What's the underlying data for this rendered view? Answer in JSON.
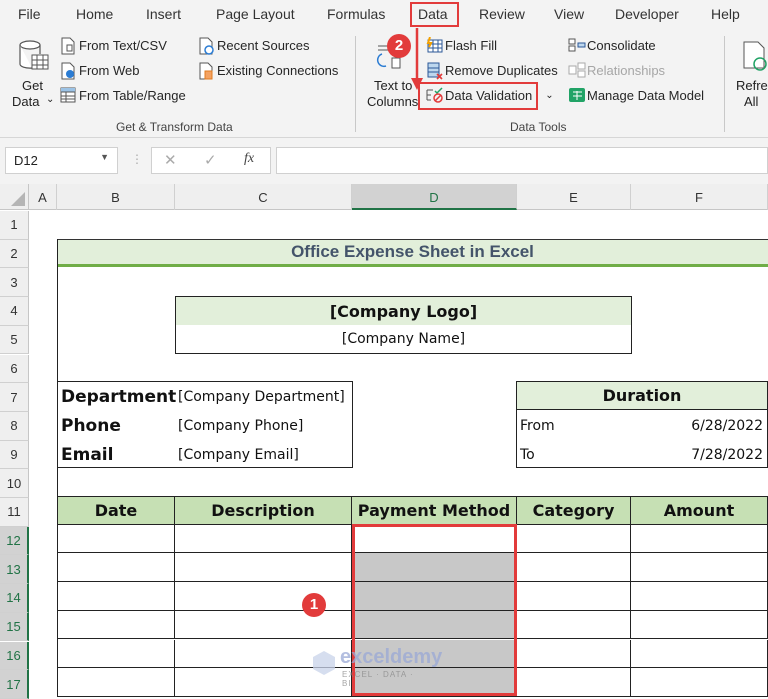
{
  "menu": {
    "tabs": [
      "File",
      "Home",
      "Insert",
      "Page Layout",
      "Formulas",
      "Data",
      "Review",
      "View",
      "Developer",
      "Help"
    ],
    "active_tab": "Data"
  },
  "ribbon": {
    "get_data": {
      "line1": "Get",
      "line2": "Data"
    },
    "from_text_csv": "From Text/CSV",
    "from_web": "From Web",
    "from_table_range": "From Table/Range",
    "recent_sources": "Recent Sources",
    "existing_connections": "Existing Connections",
    "group_get_transform": "Get & Transform Data",
    "text_to_columns": {
      "line1": "Text to",
      "line2": "Columns"
    },
    "flash_fill": "Flash Fill",
    "remove_duplicates": "Remove Duplicates",
    "data_validation": "Data Validation",
    "consolidate": "Consolidate",
    "relationships": "Relationships",
    "manage_data_model": "Manage Data Model",
    "group_data_tools": "Data Tools",
    "refresh_all": {
      "line1": "Refresh",
      "line2": "All"
    }
  },
  "formula_bar": {
    "name_box": "D12",
    "fx_label": "fx",
    "formula": ""
  },
  "columns": [
    "A",
    "B",
    "C",
    "D",
    "E",
    "F"
  ],
  "selected_column": "D",
  "rows": [
    "1",
    "2",
    "3",
    "4",
    "5",
    "6",
    "7",
    "8",
    "9",
    "10",
    "11",
    "12",
    "13",
    "14",
    "15",
    "16",
    "17"
  ],
  "sheet": {
    "title": "Office Expense Sheet in Excel",
    "company_logo": "[Company Logo]",
    "company_name": "[Company Name]",
    "info": [
      {
        "label": "Department",
        "value": "[Company Department]"
      },
      {
        "label": "Phone",
        "value": "[Company Phone]"
      },
      {
        "label": "Email",
        "value": "[Company Email]"
      }
    ],
    "duration": {
      "header": "Duration",
      "from_label": "From",
      "from_value": "6/28/2022",
      "to_label": "To",
      "to_value": "7/28/2022"
    },
    "table_headers": [
      "Date",
      "Description",
      "Payment Method",
      "Category",
      "Amount"
    ]
  },
  "annotations": {
    "step1": "1",
    "step2": "2"
  },
  "watermark": {
    "brand": "exceldemy",
    "tagline": "EXCEL · DATA · BI"
  },
  "colors": {
    "header_green": "#c6e0b4",
    "title_green": "#e2efda",
    "accent_red": "#e23b3b",
    "excel_green": "#217346"
  }
}
